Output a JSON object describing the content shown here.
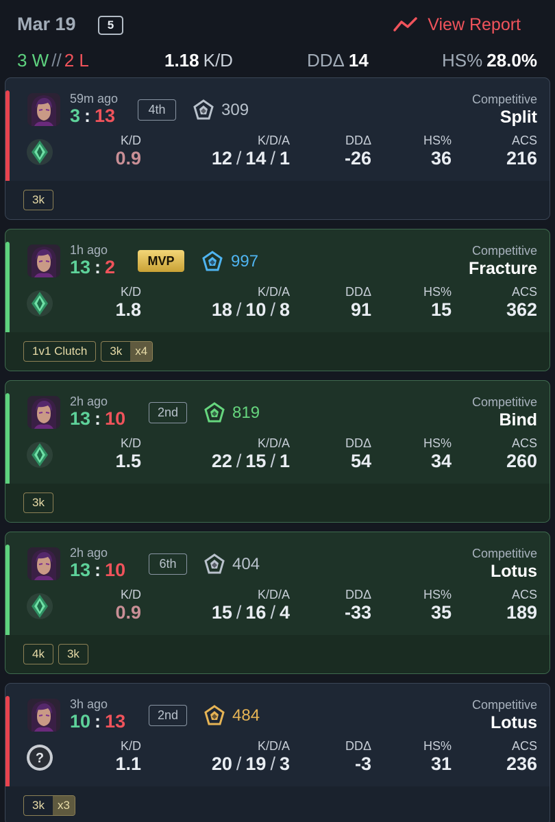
{
  "summary": {
    "date": "Mar 19",
    "match_count": "5",
    "view_report_label": "View Report",
    "wins": "3 W",
    "separator": "//",
    "losses": "2 L",
    "kd_value": "1.18",
    "kd_label": "K/D",
    "dd_label": "DDΔ",
    "dd_value": "14",
    "hs_label": "HS%",
    "hs_value": "28.0%"
  },
  "labels": {
    "kd": "K/D",
    "kda": "K/D/A",
    "dd": "DDΔ",
    "hs": "HS%",
    "acs": "ACS"
  },
  "colors": {
    "win": "#5ed27f",
    "loss": "#f0535b",
    "mvp_gold": "#e4c25c",
    "rr_blue": "#4fb4f0",
    "rr_green": "#66d67e",
    "rr_gold": "#e6b455",
    "rr_gray": "#b9c2cc",
    "kd_below_one": "#c98f96"
  },
  "matches": [
    {
      "result": "loss",
      "time_ago": "59m ago",
      "score_team": "3",
      "score_sep": ":",
      "score_enemy": "13",
      "placement": "4th",
      "mvp": "",
      "rr": "309",
      "rr_icon": "rank-badge-gray-icon",
      "rank_icon": "emerald-rank-icon",
      "mode": "Competitive",
      "map": "Split",
      "kd": "0.9",
      "kills": "12",
      "deaths": "14",
      "assists": "1",
      "dd": "-26",
      "hs": "36",
      "acs": "216",
      "tags": [
        {
          "text": "3k",
          "multiplier": ""
        }
      ]
    },
    {
      "result": "win",
      "time_ago": "1h ago",
      "score_team": "13",
      "score_sep": ":",
      "score_enemy": "2",
      "placement": "",
      "mvp": "MVP",
      "rr": "997",
      "rr_icon": "rank-badge-blue-icon",
      "rank_icon": "emerald-rank-icon",
      "mode": "Competitive",
      "map": "Fracture",
      "kd": "1.8",
      "kills": "18",
      "deaths": "10",
      "assists": "8",
      "dd": "91",
      "hs": "15",
      "acs": "362",
      "tags": [
        {
          "text": "1v1 Clutch",
          "multiplier": ""
        },
        {
          "text": "3k",
          "multiplier": "x4"
        }
      ]
    },
    {
      "result": "win",
      "time_ago": "2h ago",
      "score_team": "13",
      "score_sep": ":",
      "score_enemy": "10",
      "placement": "2nd",
      "mvp": "",
      "rr": "819",
      "rr_icon": "rank-badge-green-icon",
      "rank_icon": "emerald-rank-icon",
      "mode": "Competitive",
      "map": "Bind",
      "kd": "1.5",
      "kills": "22",
      "deaths": "15",
      "assists": "1",
      "dd": "54",
      "hs": "34",
      "acs": "260",
      "tags": [
        {
          "text": "3k",
          "multiplier": ""
        }
      ]
    },
    {
      "result": "win",
      "time_ago": "2h ago",
      "score_team": "13",
      "score_sep": ":",
      "score_enemy": "10",
      "placement": "6th",
      "mvp": "",
      "rr": "404",
      "rr_icon": "rank-badge-gray-icon",
      "rank_icon": "emerald-rank-icon",
      "mode": "Competitive",
      "map": "Lotus",
      "kd": "0.9",
      "kills": "15",
      "deaths": "16",
      "assists": "4",
      "dd": "-33",
      "hs": "35",
      "acs": "189",
      "tags": [
        {
          "text": "4k",
          "multiplier": ""
        },
        {
          "text": "3k",
          "multiplier": ""
        }
      ]
    },
    {
      "result": "loss",
      "time_ago": "3h ago",
      "score_team": "10",
      "score_sep": ":",
      "score_enemy": "13",
      "placement": "2nd",
      "mvp": "",
      "rr": "484",
      "rr_icon": "rank-badge-gold-icon",
      "rank_icon": "unknown-rank-icon",
      "mode": "Competitive",
      "map": "Lotus",
      "kd": "1.1",
      "kills": "20",
      "deaths": "19",
      "assists": "3",
      "dd": "-3",
      "hs": "31",
      "acs": "236",
      "tags": [
        {
          "text": "3k",
          "multiplier": "x3"
        }
      ]
    }
  ]
}
